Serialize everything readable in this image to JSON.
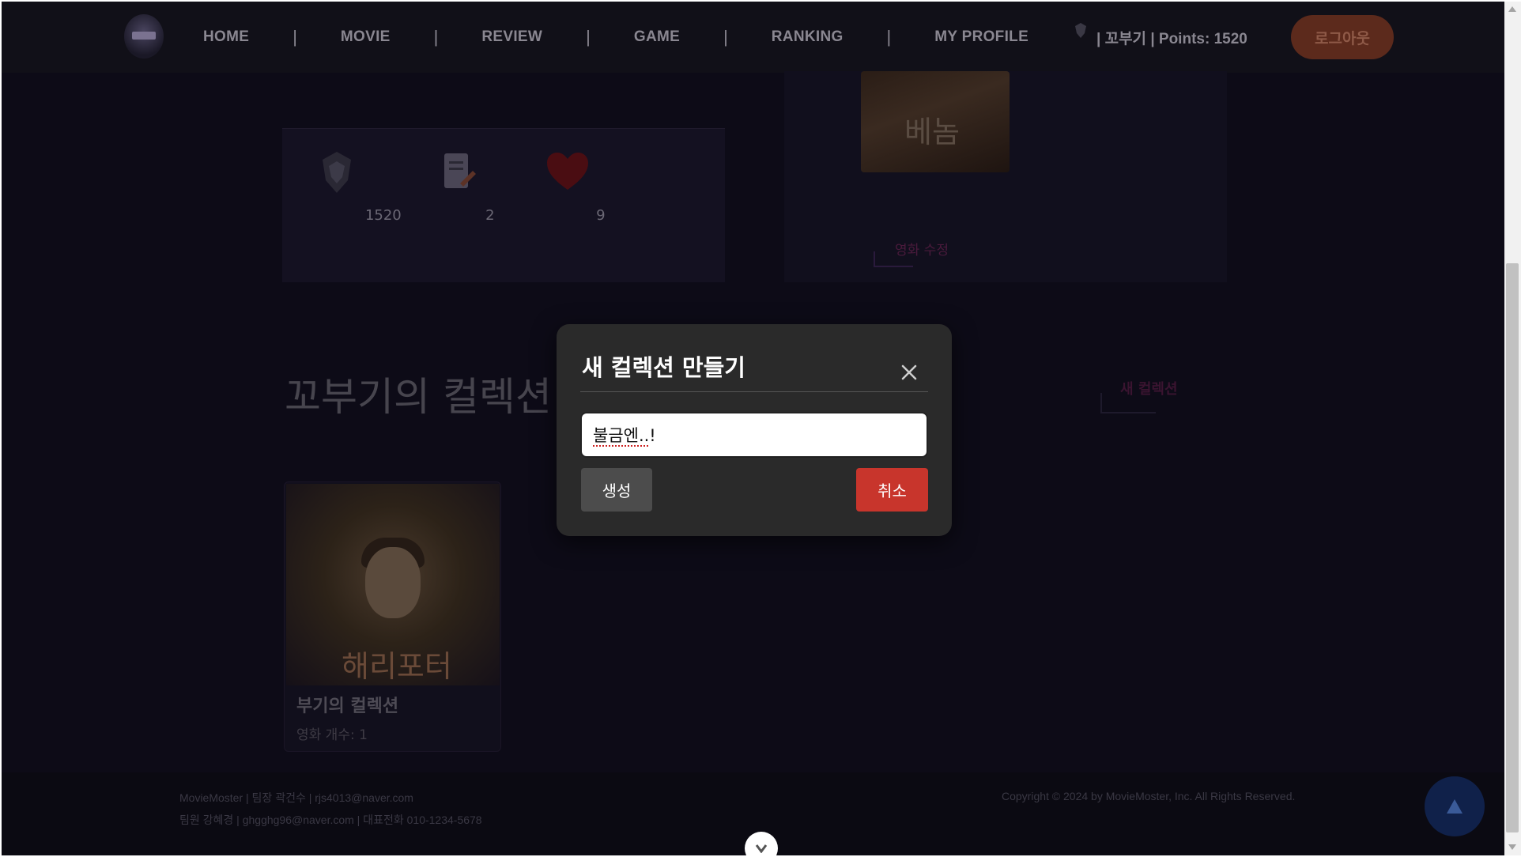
{
  "nav": {
    "items": [
      "HOME",
      "MOVIE",
      "REVIEW",
      "GAME",
      "RANKING",
      "MY PROFILE"
    ],
    "separator": "|",
    "user_text": "| 꼬부기 | Points: 1520",
    "logout_label": "로그아웃"
  },
  "stats": {
    "points": "1520",
    "reviews": "2",
    "likes": "9"
  },
  "movie_card": {
    "poster_title": "베놈",
    "edit_label": "영화 수정"
  },
  "collections": {
    "section_title": "꼬부기의 컬렉션",
    "new_label": "새 컬렉션",
    "items": [
      {
        "poster_title": "해리포터",
        "name": "부기의 컬렉션",
        "count": "영화 개수: 1"
      }
    ]
  },
  "footer": {
    "line1": "MovieMoster | 팀장 곽건수 | rjs4013@naver.com",
    "line2": "팀원 강혜경 | ghgghg96@naver.com | 대표전화 010-1234-5678",
    "copyright": "Copyright © 2024 by MovieMoster, Inc. All Rights Reserved."
  },
  "modal": {
    "title": "새 컬렉션 만들기",
    "input_value": "불금엔..!",
    "create_label": "생성",
    "cancel_label": "취소"
  },
  "colors": {
    "modal_bg": "#2a2a2a",
    "cancel_red": "#c8352c",
    "create_gray": "#4c4c4c",
    "page_bg": "#0d0b17"
  },
  "icons": [
    "user-badge-icon",
    "rank-emblem-icon",
    "review-note-icon",
    "heart-icon",
    "close-icon",
    "arrow-up-icon",
    "chevron-down-icon"
  ]
}
